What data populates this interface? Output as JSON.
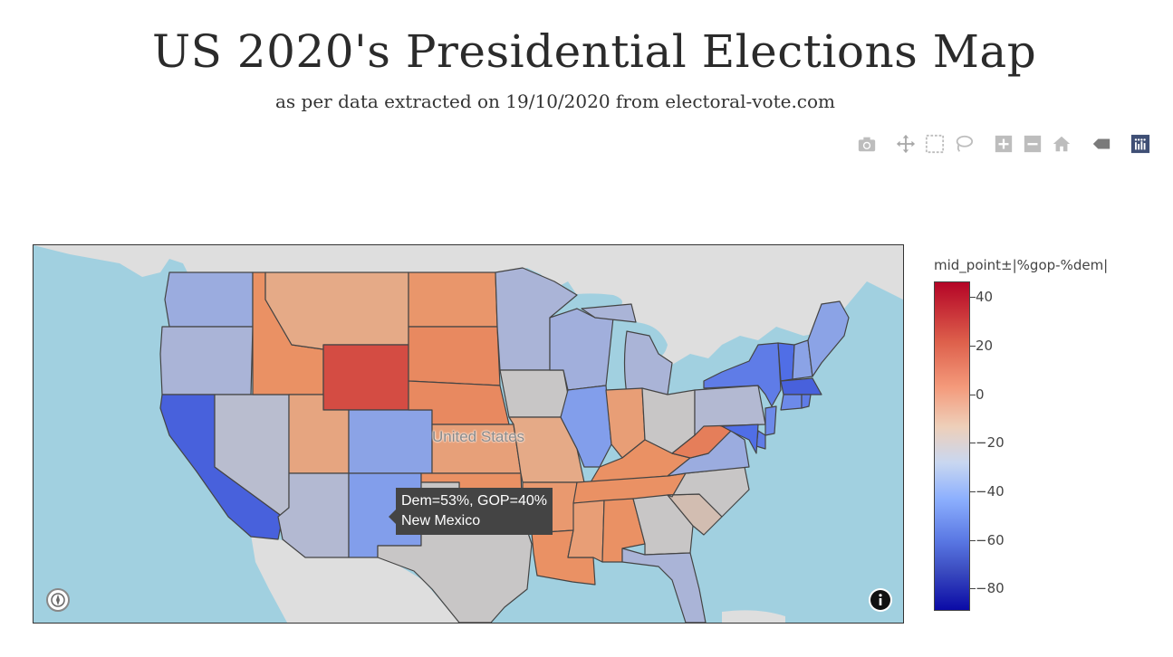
{
  "page": {
    "title": "US 2020's Presidential Elections Map",
    "subtitle": "as per data extracted on 19/10/2020 from electoral-vote.com"
  },
  "modebar": {
    "buttons": [
      {
        "name": "camera-icon",
        "label": "Download plot as a png"
      },
      {
        "name": "pan-icon",
        "label": "Pan"
      },
      {
        "name": "box-select-icon",
        "label": "Box Select"
      },
      {
        "name": "lasso-select-icon",
        "label": "Lasso Select"
      },
      {
        "name": "zoom-in-icon",
        "label": "Zoom in"
      },
      {
        "name": "zoom-out-icon",
        "label": "Zoom out"
      },
      {
        "name": "home-icon",
        "label": "Reset view"
      },
      {
        "name": "hover-icon",
        "label": "Show closest data on hover"
      },
      {
        "name": "plotly-logo-icon",
        "label": "Produced with Plotly"
      }
    ]
  },
  "map": {
    "region_label": "United States",
    "tooltip": {
      "line1": "Dem=53%, GOP=40%",
      "line2": "New Mexico"
    },
    "colors": {
      "ocean": "#a1d0e0",
      "land": "#dedede",
      "border": "#444444"
    },
    "states": [
      {
        "name": "Washington",
        "value": -30
      },
      {
        "name": "Oregon",
        "value": -25
      },
      {
        "name": "California",
        "value": -60
      },
      {
        "name": "Nevada",
        "value": -20
      },
      {
        "name": "Idaho",
        "value": 10
      },
      {
        "name": "Montana",
        "value": 0
      },
      {
        "name": "Wyoming",
        "value": 28
      },
      {
        "name": "Utah",
        "value": 2
      },
      {
        "name": "Arizona",
        "value": -22
      },
      {
        "name": "Colorado",
        "value": -35
      },
      {
        "name": "New Mexico",
        "value": -38
      },
      {
        "name": "North Dakota",
        "value": 8
      },
      {
        "name": "South Dakota",
        "value": 12
      },
      {
        "name": "Nebraska",
        "value": 12
      },
      {
        "name": "Kansas",
        "value": 4
      },
      {
        "name": "Oklahoma",
        "value": 10
      },
      {
        "name": "Texas",
        "value": -15
      },
      {
        "name": "Minnesota",
        "value": -25
      },
      {
        "name": "Iowa",
        "value": -15
      },
      {
        "name": "Missouri",
        "value": 0
      },
      {
        "name": "Arkansas",
        "value": 7
      },
      {
        "name": "Louisiana",
        "value": 10
      },
      {
        "name": "Wisconsin",
        "value": -28
      },
      {
        "name": "Illinois",
        "value": -38
      },
      {
        "name": "Michigan",
        "value": -25
      },
      {
        "name": "Indiana",
        "value": 5
      },
      {
        "name": "Ohio",
        "value": -15
      },
      {
        "name": "Kentucky",
        "value": 10
      },
      {
        "name": "Tennessee",
        "value": 10
      },
      {
        "name": "Mississippi",
        "value": 5
      },
      {
        "name": "Alabama",
        "value": 10
      },
      {
        "name": "Georgia",
        "value": -15
      },
      {
        "name": "Florida",
        "value": -25
      },
      {
        "name": "South Carolina",
        "value": -10
      },
      {
        "name": "North Carolina",
        "value": -15
      },
      {
        "name": "Virginia",
        "value": -30
      },
      {
        "name": "West Virginia",
        "value": 15
      },
      {
        "name": "Pennsylvania",
        "value": -22
      },
      {
        "name": "New York",
        "value": -50
      },
      {
        "name": "Vermont",
        "value": -55
      },
      {
        "name": "New Hampshire",
        "value": -35
      },
      {
        "name": "Maine",
        "value": -35
      },
      {
        "name": "Massachusetts",
        "value": -60
      },
      {
        "name": "Connecticut",
        "value": -45
      },
      {
        "name": "Rhode Island",
        "value": -50
      },
      {
        "name": "New Jersey",
        "value": -45
      },
      {
        "name": "Delaware",
        "value": -50
      },
      {
        "name": "Maryland",
        "value": -55
      }
    ]
  },
  "colorbar": {
    "title": "mid_point±|%gop-%dem|",
    "ticks": [
      "40",
      "20",
      "0",
      "−20",
      "−40",
      "−60",
      "−80"
    ]
  }
}
